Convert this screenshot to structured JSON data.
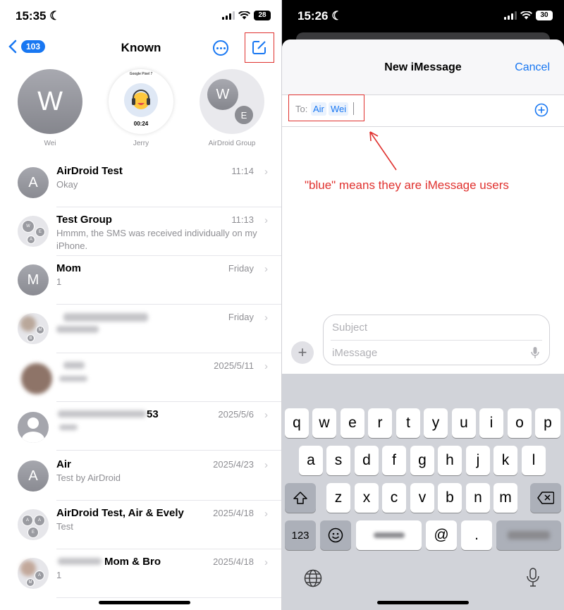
{
  "left": {
    "status": {
      "time": "15:35",
      "moon": "☾",
      "battery": "28"
    },
    "nav": {
      "back_count": "103",
      "title": "Known"
    },
    "pinned": [
      {
        "name": "Wei",
        "initial": "W"
      },
      {
        "name": "Jerry",
        "caption": "Google Pixel 7",
        "timer": "00:24"
      },
      {
        "name": "AirDroid Group",
        "initial": "W",
        "initial2": "E"
      }
    ],
    "conversations": [
      {
        "name": "AirDroid Test",
        "time": "11:14",
        "preview": "Okay",
        "initial": "A"
      },
      {
        "name": "Test Group",
        "time": "11:13",
        "preview": "Hmmm, the SMS was received individually on my iPhone.",
        "initials": [
          "W",
          "E",
          "A"
        ]
      },
      {
        "name": "Mom",
        "time": "Friday",
        "preview": "1",
        "initial": "M"
      },
      {
        "name": "",
        "time": "Friday",
        "preview": "",
        "initials": [
          "M",
          "B"
        ]
      },
      {
        "name": "",
        "time": "2025/5/11",
        "preview": ""
      },
      {
        "name": "53",
        "time": "2025/5/6",
        "preview": ""
      },
      {
        "name": "Air",
        "time": "2025/4/23",
        "preview": "Test by AirDroid",
        "initial": "A"
      },
      {
        "name": "AirDroid Test, Air & Evely",
        "time": "2025/4/18",
        "preview": "Test",
        "initials": [
          "A",
          "A",
          "E"
        ]
      },
      {
        "name": "Mom & Bro",
        "time": "2025/4/18",
        "preview": "1",
        "initials": [
          "A",
          "M"
        ]
      }
    ]
  },
  "right": {
    "status": {
      "time": "15:26",
      "moon": "☾",
      "battery": "30"
    },
    "header": {
      "title": "New iMessage",
      "cancel": "Cancel"
    },
    "to": {
      "label": "To:",
      "recipients": [
        "Air",
        "Wei"
      ]
    },
    "annotation": "\"blue\" means they are iMessage users",
    "compose": {
      "subject_placeholder": "Subject",
      "message_placeholder": "iMessage"
    },
    "keyboard": {
      "row1": [
        "q",
        "w",
        "e",
        "r",
        "t",
        "y",
        "u",
        "i",
        "o",
        "p"
      ],
      "row2": [
        "a",
        "s",
        "d",
        "f",
        "g",
        "h",
        "j",
        "k",
        "l"
      ],
      "row3": [
        "z",
        "x",
        "c",
        "v",
        "b",
        "n",
        "m"
      ],
      "numbers_key": "123",
      "at_key": "@",
      "dot_key": "."
    }
  },
  "colors": {
    "accent": "#1877f2",
    "annotation": "#e0322f"
  }
}
